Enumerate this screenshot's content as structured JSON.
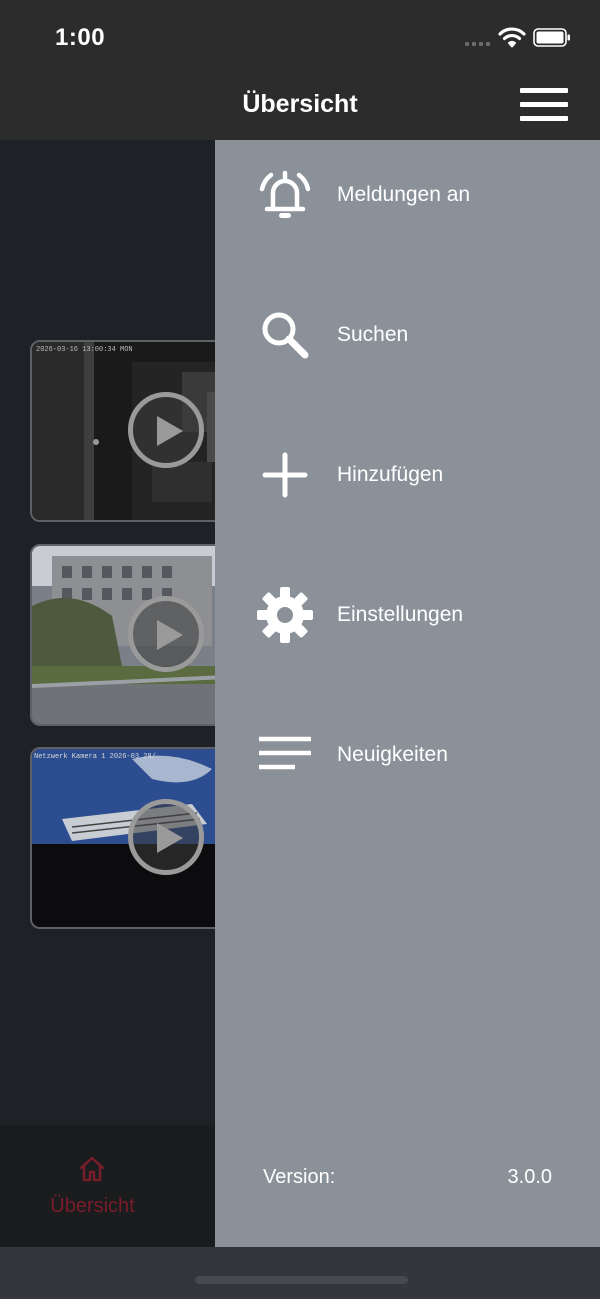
{
  "status_bar": {
    "time": "1:00"
  },
  "nav": {
    "title": "Übersicht",
    "menu_icon": "hamburger-icon"
  },
  "cameras": [
    {
      "timestamp": "2026-03-16 13:00:34 MON",
      "scene": "indoor-dark"
    },
    {
      "timestamp": "",
      "scene": "courtyard-buildings"
    },
    {
      "timestamp": "Netzwerk Kamera 1  2026-03  28/",
      "scene": "sky-building"
    }
  ],
  "tab_bar": {
    "home_label": "Übersicht",
    "home_icon": "home-icon",
    "active_color": "#7a1d2a"
  },
  "drawer": {
    "items": [
      {
        "label": "Meldungen an",
        "icon": "alarm-bell-icon"
      },
      {
        "label": "Suchen",
        "icon": "search-icon"
      },
      {
        "label": "Hinzufügen",
        "icon": "plus-icon"
      },
      {
        "label": "Einstellungen",
        "icon": "gear-icon"
      },
      {
        "label": "Neuigkeiten",
        "icon": "news-lines-icon"
      }
    ],
    "version_label": "Version:",
    "version_value": "3.0.0"
  },
  "colors": {
    "drawer_bg": "#8a9199",
    "header_bg": "#2c2c2c",
    "content_bg": "#1e2126"
  }
}
